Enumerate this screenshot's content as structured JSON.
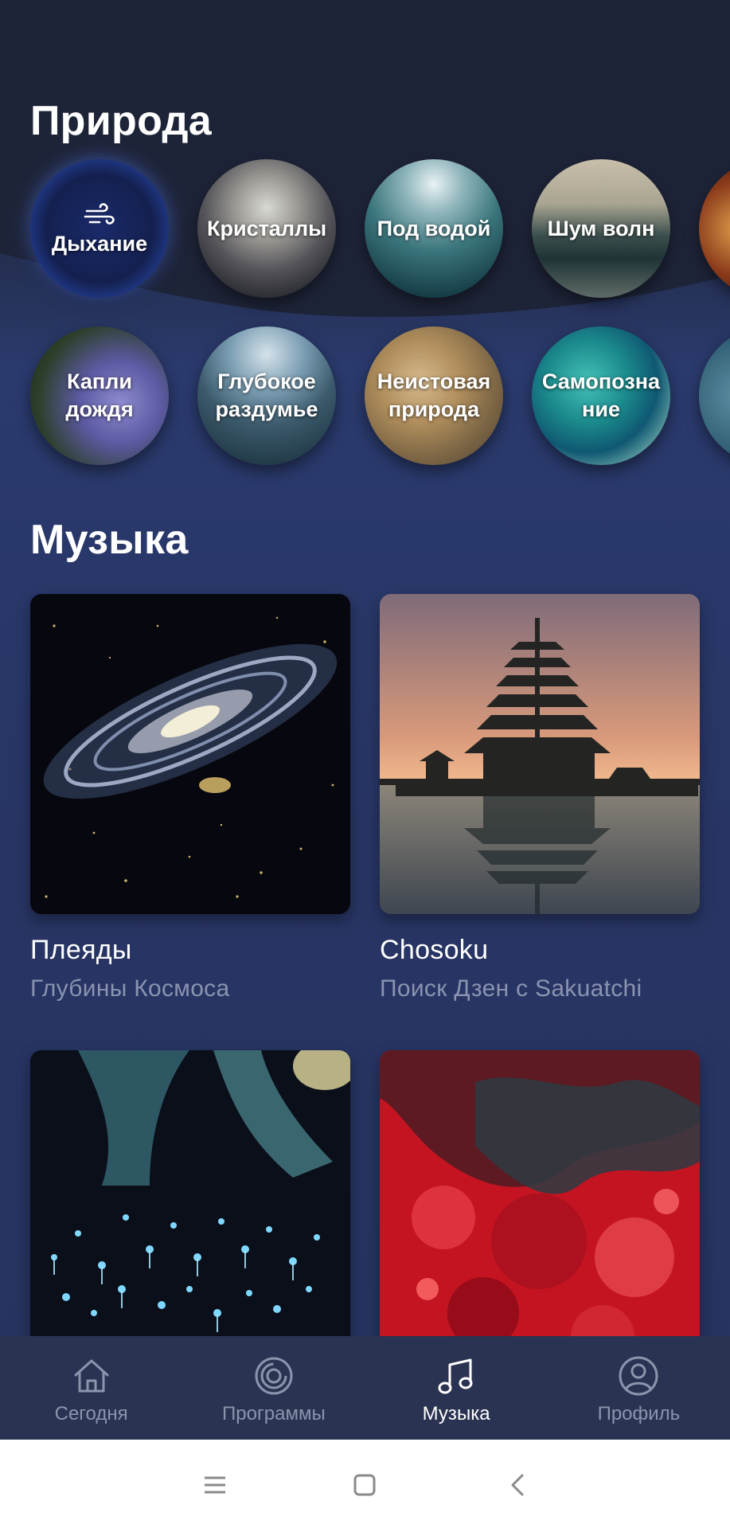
{
  "nature": {
    "title": "Природа",
    "row1": [
      {
        "label": "Дыхание",
        "icon": "wind-icon"
      },
      {
        "label": "Кристаллы"
      },
      {
        "label": "Под водой"
      },
      {
        "label": "Шум волн"
      }
    ],
    "row2": [
      {
        "label": "Капли дождя"
      },
      {
        "label": "Глубокое раздумье"
      },
      {
        "label": "Неистовая природа"
      },
      {
        "label": "Самопозна ние"
      }
    ]
  },
  "music": {
    "title": "Музыка",
    "cards": [
      {
        "title": "Плеяды",
        "subtitle": "Глубины Космоса"
      },
      {
        "title": "Chosoku",
        "subtitle": "Поиск Дзен с Sakuatchi"
      },
      {
        "title": "",
        "subtitle": ""
      },
      {
        "title": "",
        "subtitle": ""
      }
    ]
  },
  "tabbar": {
    "tabs": [
      {
        "label": "Сегодня",
        "icon": "home-icon",
        "active": false
      },
      {
        "label": "Программы",
        "icon": "target-icon",
        "active": false
      },
      {
        "label": "Музыка",
        "icon": "music-note-icon",
        "active": true
      },
      {
        "label": "Профиль",
        "icon": "profile-icon",
        "active": false
      }
    ]
  },
  "system_nav": {
    "buttons": [
      "menu-icon",
      "home-square-icon",
      "back-icon"
    ]
  },
  "colors": {
    "background": "#28355f",
    "tabbar": "#2b3352",
    "active_tab": "#ffffff",
    "inactive_tab": "#8c94ad",
    "subtitle": "#8a93b0"
  }
}
